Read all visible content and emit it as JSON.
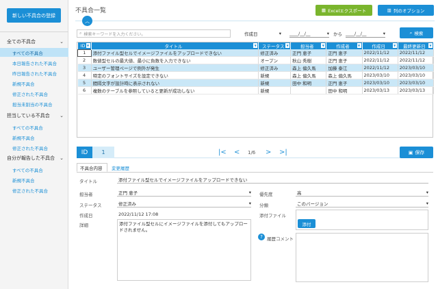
{
  "sidebar": {
    "new_button": "新しい不具合の登録",
    "groups": [
      {
        "label": "全ての不具合",
        "items": [
          "すべての不具合",
          "本日報告された不具合",
          "昨日報告された不具合",
          "新規不具合",
          "修正された不具合",
          "担当未割当の不具合"
        ]
      },
      {
        "label": "担当している不具合",
        "items": [
          "すべての不具合",
          "新規不具合",
          "修正された不具合"
        ]
      },
      {
        "label": "自分が報告した不具合",
        "items": [
          "すべての不具合",
          "新規不具合",
          "修正された不具合"
        ]
      }
    ]
  },
  "header": {
    "title": "不具合一覧",
    "excel_button": "Excelエクスポート",
    "columns_button": "列のオプション"
  },
  "search": {
    "placeholder": "検索キーワードを入力ください。",
    "date_field": "作成日",
    "date_from": "____/__/__",
    "date_to": "____/__/__",
    "range_label": "から",
    "search_button": "検索"
  },
  "table": {
    "columns": [
      "ID",
      "タイトル",
      "ステータス",
      "担当者",
      "作成者",
      "作成日",
      "最終更新日"
    ],
    "rows": [
      [
        "1",
        "添付ファイル型セルでイメージファイルをアップロードできない",
        "修正済み",
        "正門 恵子",
        "正門 恵子",
        "2022/11/12",
        "2022/11/12"
      ],
      [
        "2",
        "数値型セルの最大値、最小に負数を入力できない",
        "オープン",
        "秋山 秀樹",
        "正門 恵子",
        "2022/11/12",
        "2022/11/12"
      ],
      [
        "3",
        "ユーザー管理ページで例外が発生",
        "修正済み",
        "森上 偏久馬",
        "加藤 泰江",
        "2022/11/12",
        "2023/03/10"
      ],
      [
        "4",
        "特定のフォントサイズを設定できない",
        "新規",
        "森上 偏久馬",
        "森上 偏久馬",
        "2023/03/10",
        "2023/03/10"
      ],
      [
        "5",
        "間隔文字が設計時に表示されない",
        "新規",
        "田中 和明",
        "正門 恵子",
        "2023/03/10",
        "2023/03/10"
      ],
      [
        "6",
        "複数のテーブルを参照していると更新が成功しない",
        "新規",
        "",
        "田中 和明",
        "2023/03/13",
        "2023/03/13"
      ]
    ]
  },
  "detail": {
    "id_label": "ID",
    "id_value": "1",
    "page_info": "1/6",
    "save_button": "保存",
    "tabs": [
      "不具合内容",
      "変更履歴"
    ],
    "title_label": "タイトル",
    "title_value": "添付ファイル型セルでイメージファイルをアップロードできない",
    "assignee_label": "担当者",
    "assignee_value": "正門 恵子",
    "priority_label": "優先度",
    "priority_value": "高",
    "status_label": "ステータス",
    "status_value": "修正済み",
    "category_label": "分類",
    "category_value": "このバージョン",
    "created_label": "作成日",
    "created_value": "2022/11/12 17:08",
    "attachment_label": "添付ファイル",
    "attach_button": "添付",
    "details_label": "詳細",
    "details_value": "添付ファイル型セルにイメージファイルを添付してもアップロードされません。",
    "history_label": "履歴コメント"
  }
}
